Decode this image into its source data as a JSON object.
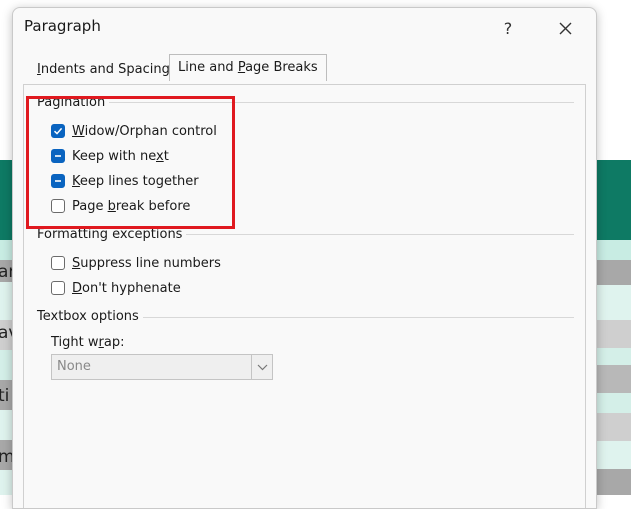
{
  "background": {
    "fragments": [
      "ar",
      "av",
      "ti",
      "m"
    ]
  },
  "dialog": {
    "title": "Paragraph",
    "help_label": "?",
    "close_label": "✕",
    "tabs": [
      {
        "pre": "",
        "key": "I",
        "post": "ndents and Spacing",
        "active": false
      },
      {
        "pre": "Line and ",
        "key": "P",
        "post": "age Breaks",
        "active": true
      }
    ],
    "pagination": {
      "label": "Pagination",
      "options": [
        {
          "pre": "",
          "key": "W",
          "post": "idow/Orphan control",
          "state": "checked"
        },
        {
          "pre": "Keep with ne",
          "key": "x",
          "post": "t",
          "state": "mixed"
        },
        {
          "pre": "",
          "key": "K",
          "post": "eep lines together",
          "state": "mixed"
        },
        {
          "pre": "Page ",
          "key": "b",
          "post": "reak before",
          "state": "unchecked"
        }
      ]
    },
    "formatting": {
      "label": "Formatting exceptions",
      "options": [
        {
          "pre": "",
          "key": "S",
          "post": "uppress line numbers",
          "state": "unchecked"
        },
        {
          "pre": "",
          "key": "D",
          "post": "on't hyphenate",
          "state": "unchecked"
        }
      ]
    },
    "textbox": {
      "label": "Textbox options",
      "tight_wrap_pre": "Tight w",
      "tight_wrap_key": "r",
      "tight_wrap_post": "ap:",
      "tight_wrap_value": "None"
    }
  },
  "colors": {
    "accent": "#0a64c0",
    "highlight": "#e0191f",
    "sheet_dark": "#0e7a64",
    "sheet_light": "#c8ece3"
  }
}
